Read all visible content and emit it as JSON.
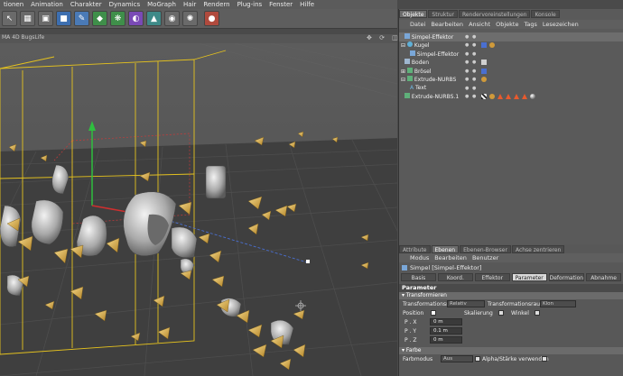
{
  "menu": {
    "items": [
      "tionen",
      "Animation",
      "Charakter",
      "Dynamics",
      "MoGraph",
      "Hair",
      "Rendern",
      "Plug-ins",
      "Fenster",
      "Hilfe"
    ]
  },
  "viewport": {
    "title": "MA 4D BugsLife",
    "controls": "✥ ⟳ ◫ ▭"
  },
  "right_tabs": [
    "Objekte",
    "Struktur",
    "Rendervoreinstellungen",
    "Konsole"
  ],
  "obj_menu": [
    "Datei",
    "Bearbeiten",
    "Ansicht",
    "Objekte",
    "Tags",
    "Lesezeichen"
  ],
  "objects": [
    {
      "name": "Simpel-Effektor"
    },
    {
      "name": "Kugel"
    },
    {
      "name": "Simpel-Effektor"
    },
    {
      "name": "Boden"
    },
    {
      "name": "Brösel"
    },
    {
      "name": "Extrude-NURBS"
    },
    {
      "name": "Text"
    },
    {
      "name": "Extrude-NURBS.1"
    }
  ],
  "attr_tabs": [
    "Attribute",
    "Ebenen",
    "Ebenen-Browser",
    "Achse zentrieren"
  ],
  "attr_menu": [
    "Modus",
    "Bearbeiten",
    "Benutzer"
  ],
  "attr_title": "Simpel [Simpel-Effektor]",
  "attr_buttons": [
    "Basis",
    "Koord.",
    "Effektor",
    "Parameter",
    "Deformation",
    "Abnahme"
  ],
  "sections": {
    "parameter": "Parameter",
    "transformieren": "Transformieren",
    "farbe": "Farbe"
  },
  "params": {
    "transform_mode_label": "Transformationsmodus",
    "transform_mode_value": "Relativ",
    "transform_space_label": "Transformationsraum",
    "transform_space_value": "Klon",
    "position_label": "Position",
    "scale_label": "Skalierung",
    "angle_label": "Winkel",
    "px_label": "P . X",
    "px_value": "0 m",
    "py_label": "P . Y",
    "py_value": "0.1 m",
    "pz_label": "P . Z",
    "pz_value": "0 m",
    "color_mode_label": "Farbmodus",
    "color_mode_value": "Aus",
    "alpha_label": "Alpha/Stärke verwenden"
  },
  "colors": {
    "bg_panel": "#5a5a5a",
    "viewport": "#555555",
    "accent_orange": "#e85a2e",
    "yellow_cage": "#e5c21e"
  }
}
